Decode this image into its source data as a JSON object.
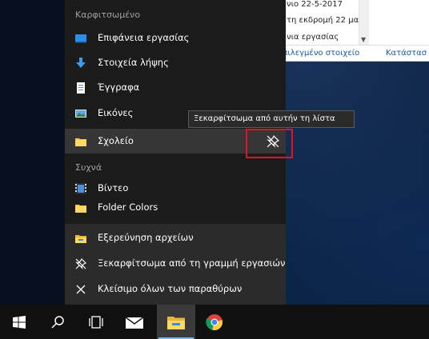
{
  "explorer_partial": {
    "row1": "νιο 22-5-2017",
    "row2": "τη εκδρομή 22 μαι",
    "row3": "νια εργασίας",
    "header_selected": "επιλεγμένο στοιχείο",
    "header_status": "Κατάστασ"
  },
  "jumplist": {
    "pinned_title": "Καρφιτσωμένο",
    "pinned_items": [
      {
        "label": "Επιφάνεια εργασίας",
        "icon": "desktop-icon"
      },
      {
        "label": "Στοιχεία λήψης",
        "icon": "downloads-icon"
      },
      {
        "label": "Έγγραφα",
        "icon": "documents-icon"
      },
      {
        "label": "Εικόνες",
        "icon": "pictures-icon"
      },
      {
        "label": "Σχολείο",
        "icon": "folder-icon"
      }
    ],
    "frequent_title": "Συχνά",
    "frequent_items": [
      {
        "label": "Βίντεο",
        "icon": "videos-icon"
      },
      {
        "label": "Folder Colors",
        "icon": "folder-icon"
      }
    ],
    "tasks": [
      {
        "label": "Εξερεύνηση αρχείων",
        "icon": "file-explorer-icon"
      },
      {
        "label": "Ξεκαρφίτσωμα από τη γραμμή εργασιών",
        "icon": "unpin-icon"
      },
      {
        "label": "Κλείσιμο όλων των παραθύρων",
        "icon": "close-icon"
      }
    ]
  },
  "tooltip": {
    "text": "Ξεκαρφίτσωμα από αυτήν τη λίστα"
  },
  "taskbar": {
    "buttons": [
      "start-icon",
      "search-icon",
      "task-view-icon",
      "mail-icon",
      "file-explorer-icon",
      "chrome-icon"
    ],
    "active": "file-explorer-icon"
  },
  "colors": {
    "highlight": "#e81123",
    "jumplist_bg": "#1b1b1b",
    "taskbar_bg": "#101010",
    "accent": "#76b9ed"
  }
}
